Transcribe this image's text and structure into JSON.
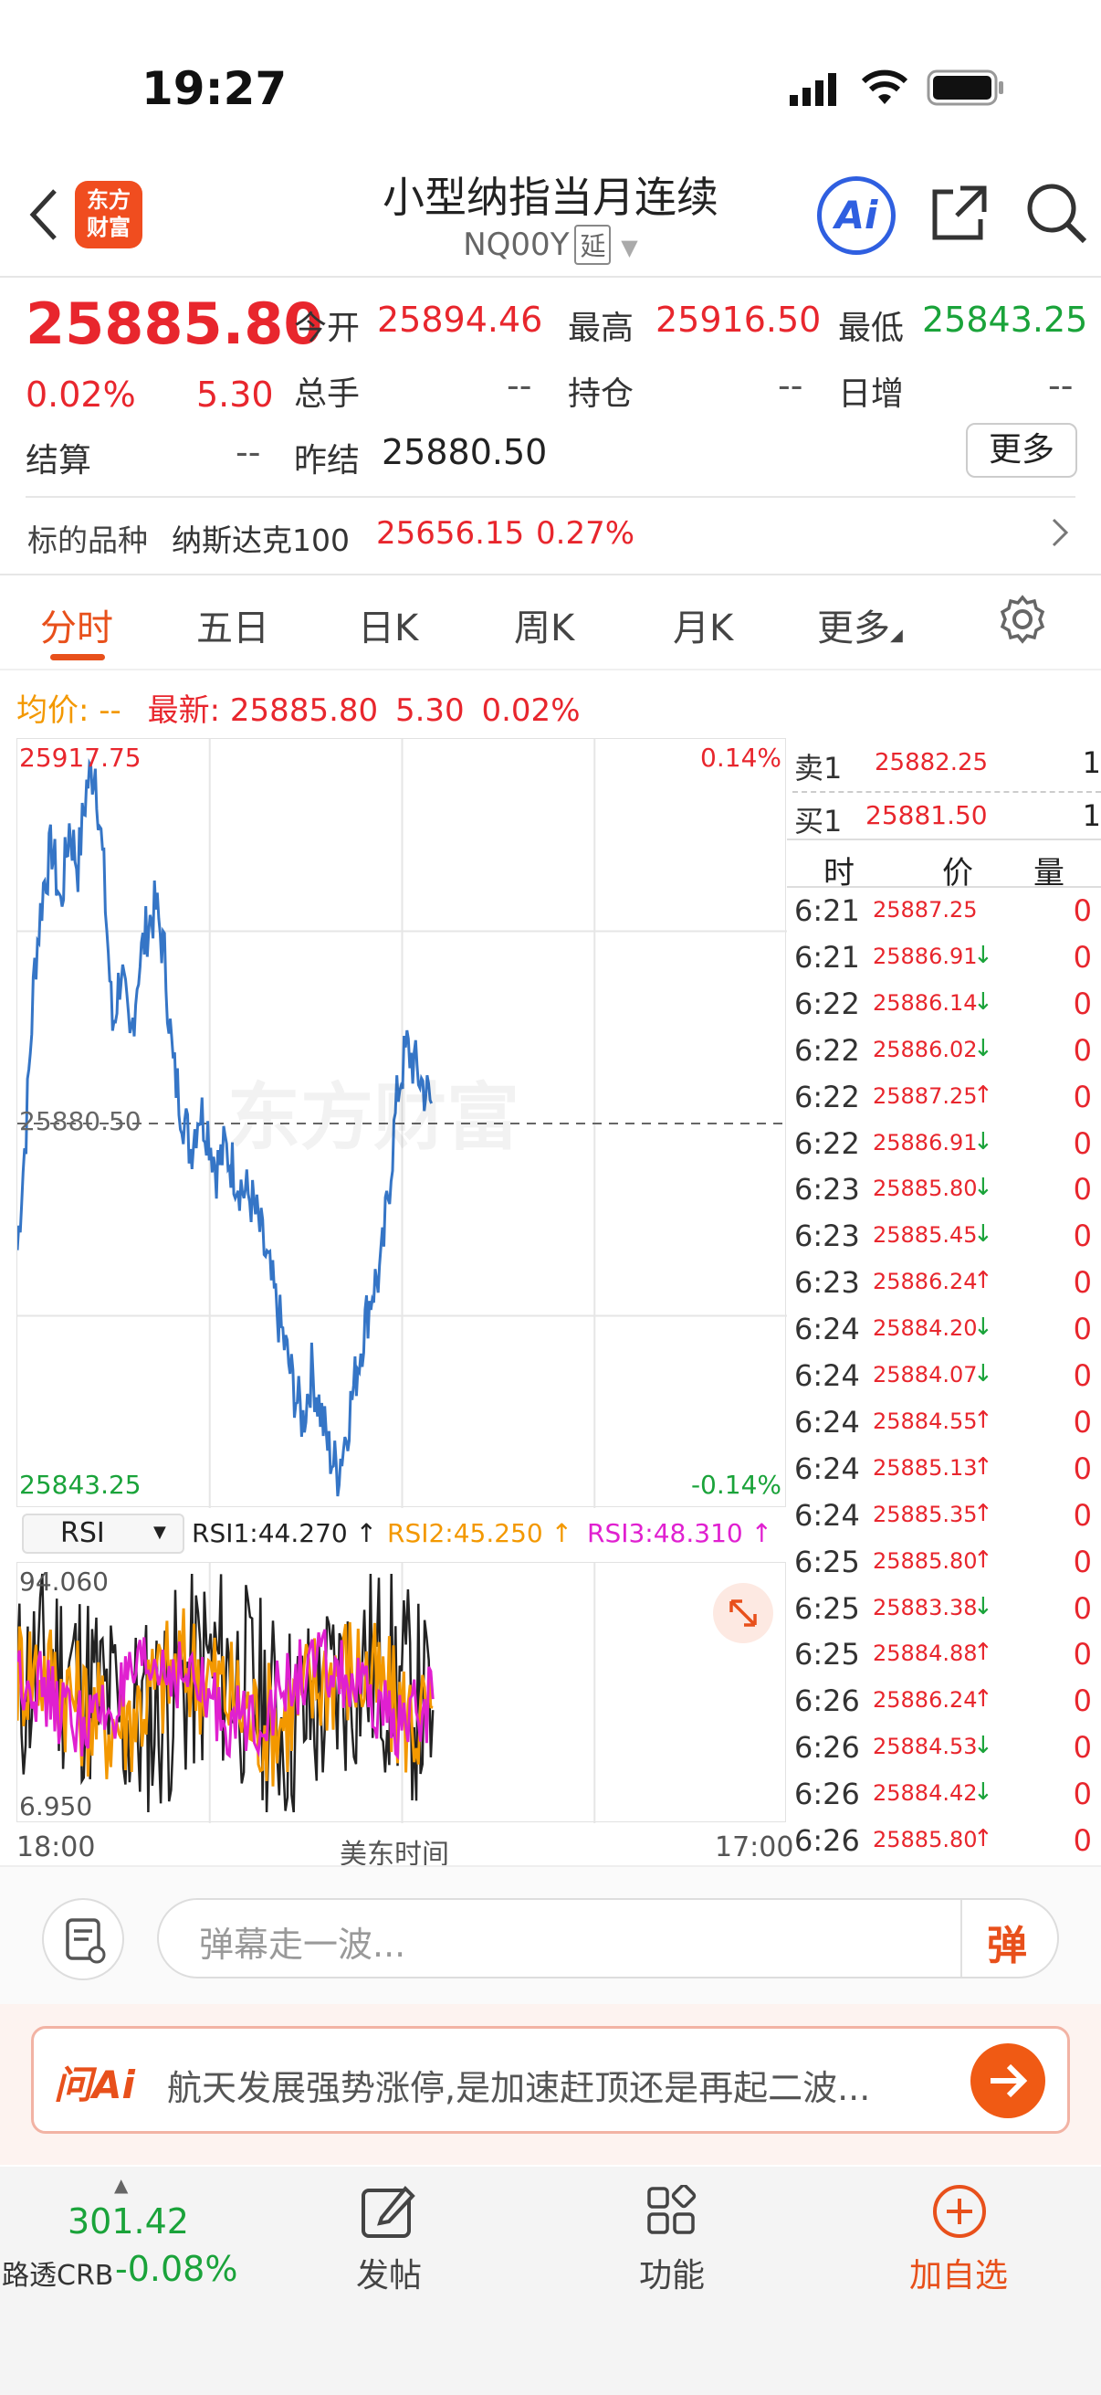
{
  "status_bar": {
    "time": "19:27"
  },
  "header": {
    "title": "小型纳指当月连续",
    "code": "NQ00Y",
    "delay_badge": "延",
    "logo_text": "东方财富",
    "ai_label": "Ai"
  },
  "quote": {
    "price": "25885.80",
    "change_pct": "0.02%",
    "change": "5.30",
    "open_label": "今开",
    "open": "25894.46",
    "high_label": "最高",
    "high": "25916.50",
    "low_label": "最低",
    "low": "25843.25",
    "volume_label": "总手",
    "volume": "--",
    "oi_label": "持仓",
    "oi": "--",
    "daily_inc_label": "日增",
    "daily_inc": "--",
    "settle_label": "结算",
    "settle": "--",
    "prev_settle_label": "昨结",
    "prev_settle": "25880.50",
    "more_label": "更多"
  },
  "underlying": {
    "label": "标的品种",
    "name": "纳斯达克100",
    "price": "25656.15",
    "pct": "0.27%"
  },
  "tabs": [
    "分时",
    "五日",
    "日K",
    "周K",
    "月K",
    "更多"
  ],
  "chart_header": {
    "avg_label": "均价:",
    "avg_value": "--",
    "latest_label": "最新:",
    "latest_value": "25885.80",
    "latest_change": "5.30",
    "latest_pct": "0.02%"
  },
  "chart_labels": {
    "top_price": "25917.75",
    "top_pct": "0.14%",
    "mid_price": "25880.50",
    "bottom_price": "25843.25",
    "bottom_pct": "-0.14%",
    "watermark": "东方财富",
    "rsi_selector": "RSI",
    "rsi1": "RSI1:44.270 ↑",
    "rsi2": "RSI2:45.250 ↑",
    "rsi3": "RSI3:48.310 ↑",
    "rsi_top": "94.060",
    "rsi_bottom": "6.950",
    "time_start": "18:00",
    "time_mid": "美东时间",
    "time_end": "17:00"
  },
  "chart_data": {
    "type": "line",
    "title": "",
    "ylim": [
      25843.25,
      25917.75
    ],
    "ref_line": 25880.5,
    "series": [
      {
        "values": [
          25868,
          25880,
          25896,
          25904,
          25908,
          25902,
          25910,
          25906,
          25914,
          25916,
          25905,
          25890,
          25896,
          25888,
          25896,
          25900,
          25902,
          25897,
          25886,
          25882,
          25878,
          25882,
          25880,
          25876,
          25878,
          25876,
          25874,
          25873,
          25870,
          25866,
          25862,
          25858,
          25854,
          25851,
          25856,
          25852,
          25848,
          25846,
          25850,
          25855,
          25860,
          25864,
          25866,
          25875,
          25884,
          25888,
          25886,
          25884,
          25882
        ]
      }
    ],
    "rsi": {
      "ylim": [
        6.95,
        94.06
      ],
      "series": [
        {
          "name": "RSI1",
          "color": "#222222",
          "last": 44.27
        },
        {
          "name": "RSI2",
          "color": "#f39800",
          "last": 45.25
        },
        {
          "name": "RSI3",
          "color": "#e020d0",
          "last": 48.31
        }
      ]
    }
  },
  "orderbook": {
    "ask_label": "卖1",
    "ask_price": "25882.25",
    "ask_vol": "1",
    "bid_label": "买1",
    "bid_price": "25881.50",
    "bid_vol": "1",
    "col_time": "时",
    "col_price": "价",
    "col_vol": "量"
  },
  "ticks": [
    {
      "time": "6:21",
      "price": "25887.25",
      "dir": "",
      "vol": "0"
    },
    {
      "time": "6:21",
      "price": "25886.91",
      "dir": "↓",
      "vol": "0"
    },
    {
      "time": "6:22",
      "price": "25886.14",
      "dir": "↓",
      "vol": "0"
    },
    {
      "time": "6:22",
      "price": "25886.02",
      "dir": "↓",
      "vol": "0"
    },
    {
      "time": "6:22",
      "price": "25887.25",
      "dir": "↑",
      "vol": "0"
    },
    {
      "time": "6:22",
      "price": "25886.91",
      "dir": "↓",
      "vol": "0"
    },
    {
      "time": "6:23",
      "price": "25885.80",
      "dir": "↓",
      "vol": "0"
    },
    {
      "time": "6:23",
      "price": "25885.45",
      "dir": "↓",
      "vol": "0"
    },
    {
      "time": "6:23",
      "price": "25886.24",
      "dir": "↑",
      "vol": "0"
    },
    {
      "time": "6:24",
      "price": "25884.20",
      "dir": "↓",
      "vol": "0"
    },
    {
      "time": "6:24",
      "price": "25884.07",
      "dir": "↓",
      "vol": "0"
    },
    {
      "time": "6:24",
      "price": "25884.55",
      "dir": "↑",
      "vol": "0"
    },
    {
      "time": "6:24",
      "price": "25885.13",
      "dir": "↑",
      "vol": "0"
    },
    {
      "time": "6:24",
      "price": "25885.35",
      "dir": "↑",
      "vol": "0"
    },
    {
      "time": "6:25",
      "price": "25885.80",
      "dir": "↑",
      "vol": "0"
    },
    {
      "time": "6:25",
      "price": "25883.38",
      "dir": "↓",
      "vol": "0"
    },
    {
      "time": "6:25",
      "price": "25884.88",
      "dir": "↑",
      "vol": "0"
    },
    {
      "time": "6:26",
      "price": "25886.24",
      "dir": "↑",
      "vol": "0"
    },
    {
      "time": "6:26",
      "price": "25884.53",
      "dir": "↓",
      "vol": "0"
    },
    {
      "time": "6:26",
      "price": "25884.42",
      "dir": "↓",
      "vol": "0"
    },
    {
      "time": "6:26",
      "price": "25885.80",
      "dir": "↑",
      "vol": "0"
    }
  ],
  "danmu": {
    "placeholder": "弹幕走一波...",
    "button": "弹"
  },
  "ask_ai": {
    "logo": "问Ai",
    "text": "航天发展强势涨停,是加速赶顶还是再起二波..."
  },
  "bottom_bar": {
    "index_value": "301.42",
    "index_name": "路透CRB",
    "index_pct": "-0.08%",
    "post_label": "发帖",
    "func_label": "功能",
    "fav_label": "加自选"
  },
  "colors": {
    "up": "#e8262d",
    "down": "#1aa33a",
    "accent": "#e8501b",
    "line": "#3575c6"
  }
}
